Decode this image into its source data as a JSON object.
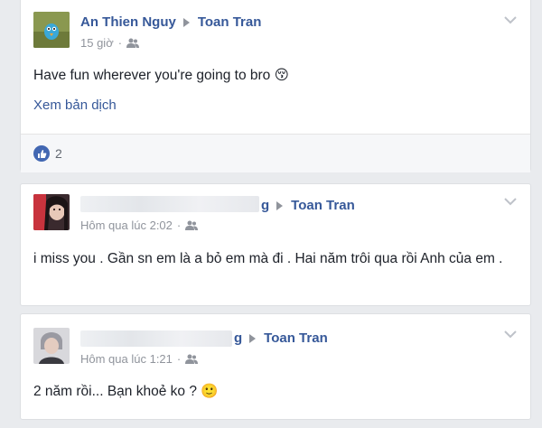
{
  "posts": [
    {
      "author": "An Thien Nguy",
      "target": "Toan Tran",
      "time": "15 giờ",
      "audience_icon": "friends-icon",
      "text": "Have fun wherever you're going to bro 😚",
      "translate_link": "Xem bản dịch",
      "like_count": "2"
    },
    {
      "author_partial": "g",
      "target": "Toan Tran",
      "time": "Hôm qua lúc 2:02",
      "audience_icon": "friends-icon",
      "text": "i miss you . Gần sn em là a bỏ em mà đi . Hai năm trôi qua rồi Anh của em ."
    },
    {
      "author_partial": "g",
      "target": "Toan Tran",
      "time": "Hôm qua lúc 1:21",
      "audience_icon": "friends-icon",
      "text": "2 năm rồi... Bạn khoẻ ko ? 🙂"
    }
  ],
  "colors": {
    "link": "#365899",
    "meta": "#90949c",
    "like_blue": "#4267b2",
    "background": "#e9ebee"
  }
}
